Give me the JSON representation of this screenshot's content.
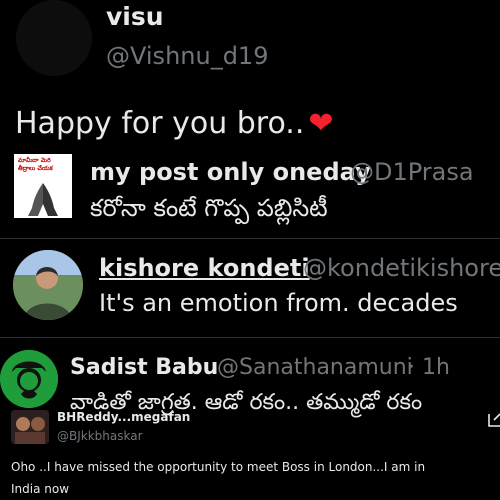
{
  "post1": {
    "name": "visu",
    "handle": "@Vishnu_d19",
    "text": "Happy for you bro..",
    "heart": "❤",
    "heart_color": "#f4212e"
  },
  "post2": {
    "name": "my post only oneday",
    "handle": "@D1Prasa",
    "text": "కరోనా కంటే గొప్ప పబ్లిసిటీ",
    "avatar_text": "మామీదా మెరి తీద్రాలు చేయక"
  },
  "post3": {
    "name": "kishore kondeti",
    "handle": "@kondetikishore",
    "text": "It's an emotion from. decades"
  },
  "post4": {
    "name": "Sadist Babu",
    "handle": "@Sanathanamuni",
    "time": "· 1h",
    "text": "వాడితో జాగ్రత. ఆడో రకం.. తమ్ముడో రకం",
    "avatar_bg": "#1f9d3a"
  },
  "post5": {
    "name": "BHReddy...megafan",
    "handle": "@BJkkbhaskar",
    "text_line1": "Oho ..I have missed the opportunity to meet Boss in London...I am in",
    "text_line2": "India now"
  }
}
